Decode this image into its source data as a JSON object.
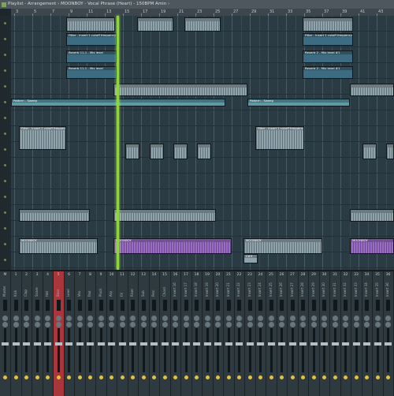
{
  "window": {
    "title": "Playlist - Arrangement › MOONBOY - Vocal Phrase (Heart) - 150BPM Amin ›"
  },
  "ruler": {
    "bars": [
      "3",
      "5",
      "7",
      "9",
      "11",
      "13",
      "15",
      "17",
      "19",
      "21",
      "23",
      "25",
      "27",
      "29",
      "31",
      "33",
      "35",
      "37",
      "39",
      "41",
      "43"
    ]
  },
  "clips": {
    "filter_lead": "Filter - Insert 1 cutoff frequency",
    "reverb_mix": "Reverb 11-1 - Mix level",
    "reverb_mix_alt": "Reverb 2 - Mix level #1",
    "riser": "Pattern - Sweep",
    "filter_insert": "Filter - Insert 2 cutoff frequency",
    "moonboy": "MOONBOY",
    "bass_label": "Bass",
    "small_label": "1/4",
    "ns_label": "C#3"
  },
  "mixer": {
    "numbers": [
      "M",
      "1",
      "2",
      "3",
      "4",
      "5",
      "6",
      "7",
      "8",
      "9",
      "10",
      "11",
      "12",
      "13",
      "14",
      "15",
      "16",
      "17",
      "18",
      "19",
      "20",
      "21",
      "22",
      "23",
      "24",
      "25",
      "26",
      "27",
      "28",
      "29",
      "30",
      "31",
      "32",
      "33",
      "34",
      "35",
      "36"
    ],
    "names": [
      "Master",
      "Kick",
      "Clap",
      "Snare",
      "Hat",
      "Bass",
      "Lead",
      "Vox",
      "Pad",
      "Pluck",
      "Arp",
      "FX",
      "Riser",
      "Sub",
      "Perc",
      "Chord",
      "Insert 16",
      "Insert 17",
      "Insert 18",
      "Insert 19",
      "Insert 20",
      "Insert 21",
      "Insert 22",
      "Insert 23",
      "Insert 24",
      "Insert 25",
      "Insert 26",
      "Insert 27",
      "Insert 28",
      "Insert 29",
      "Insert 30",
      "Insert 31",
      "Insert 32",
      "Insert 33",
      "Insert 34",
      "Insert 35",
      "Insert 36"
    ],
    "selected_color": "#a8363a"
  }
}
